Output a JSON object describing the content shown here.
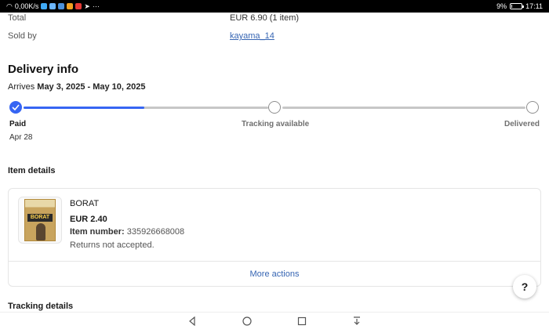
{
  "status_bar": {
    "speed": "0,00K/s",
    "more": "···",
    "battery": "9%",
    "time": "17:11",
    "battery_level": 0.09
  },
  "order": {
    "total_label": "Total",
    "total_value": "EUR 6.90 (1 item)",
    "sold_by_label": "Sold by",
    "seller": "kayama_14"
  },
  "delivery": {
    "title": "Delivery info",
    "arrives_prefix": "Arrives ",
    "arrives_range": "May 3, 2025 - May 10, 2025",
    "progress": 0.24,
    "steps": [
      {
        "label": "Paid",
        "date": "Apr 28",
        "done": true
      },
      {
        "label": "Tracking available",
        "date": "",
        "done": false
      },
      {
        "label": "Delivered",
        "date": "",
        "done": false
      }
    ]
  },
  "item_details": {
    "title": "Item details",
    "item_title": "BORAT",
    "price": "EUR 2.40",
    "number_label": "Item number:",
    "number_value": "335926668008",
    "returns": "Returns not accepted.",
    "more_actions": "More actions",
    "poster_text": "BORAT"
  },
  "help_label": "?",
  "tracking": {
    "title": "Tracking details"
  },
  "colors": {
    "accent": "#3665f3",
    "link": "#3665b3"
  }
}
